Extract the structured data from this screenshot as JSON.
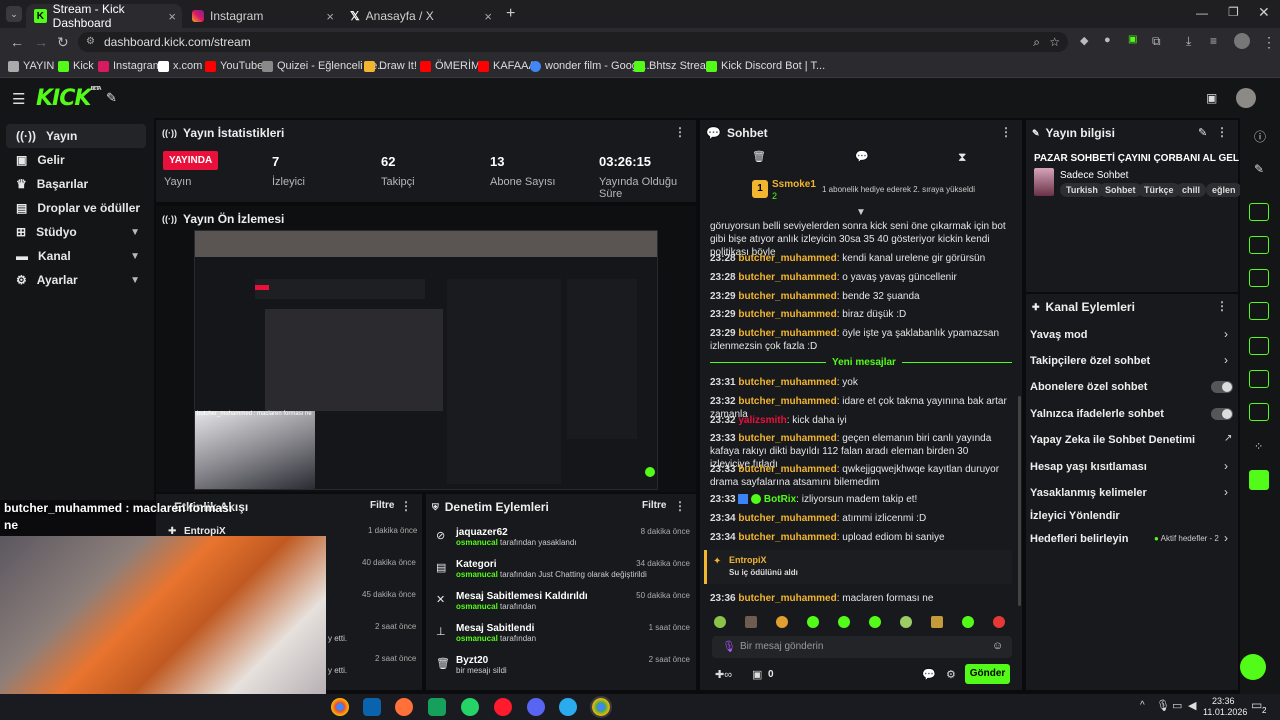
{
  "browser": {
    "tabs": [
      {
        "label": "Stream - Kick Dashboard",
        "active": true
      },
      {
        "label": "Instagram",
        "active": false
      },
      {
        "label": "Anasayfa / X",
        "active": false
      }
    ],
    "url": "dashboard.kick.com/stream",
    "bookmarks": [
      "YAYIN",
      "Kick",
      "Instagram",
      "x.com",
      "YouTube",
      "Quizei - Eğlenceli ve...",
      "Draw It!",
      "ÖMERİM",
      "KAFAAA",
      "wonder film - Googl...",
      "Bhtsz Stream",
      "Kick Discord Bot | T..."
    ]
  },
  "kick": {
    "logo": "KICK",
    "badge": "BETA",
    "accent": "#53fc18"
  },
  "sidebar": {
    "items": [
      {
        "label": "Yayın",
        "icon": "broadcast-icon"
      },
      {
        "label": "Gelir",
        "icon": "wallet-icon"
      },
      {
        "label": "Başarılar",
        "icon": "trophy-icon"
      },
      {
        "label": "Droplar ve ödüller",
        "icon": "gift-icon"
      },
      {
        "label": "Stüdyo",
        "icon": "grid-icon"
      },
      {
        "label": "Kanal",
        "icon": "user-icon"
      },
      {
        "label": "Ayarlar",
        "icon": "gear-icon"
      }
    ]
  },
  "stats": {
    "title": "Yayın İstatistikleri",
    "live_badge": "YAYINDA",
    "live_label": "Yayın",
    "items": [
      {
        "value": "7",
        "label": "İzleyici"
      },
      {
        "value": "62",
        "label": "Takipçi"
      },
      {
        "value": "13",
        "label": "Abone Sayısı"
      },
      {
        "value": "03:26:15",
        "label": "Yayında Olduğu Süre"
      }
    ]
  },
  "preview": {
    "title": "Yayın Ön İzlemesi",
    "overlay_user": "butcher_muhammed",
    "overlay_text": "maclaren forması ne"
  },
  "activity": {
    "title": "Etkinlik Akışı",
    "filter": "Filtre",
    "items": [
      {
        "user": "EntropiX",
        "time": ""
      },
      {
        "user": "",
        "time": "1 dakika önce"
      },
      {
        "user": "",
        "time": "40 dakika önce"
      },
      {
        "user": "",
        "time": "45 dakika önce"
      },
      {
        "user": "",
        "time": "2 saat önce",
        "sub": "y etti."
      },
      {
        "user": "",
        "time": "2 saat önce",
        "sub": "y etti."
      }
    ]
  },
  "audit": {
    "title": "Denetim Eylemleri",
    "filter": "Filtre",
    "items": [
      {
        "title": "jaquazer62",
        "actor": "osmanucal",
        "rest": "tarafından yasaklandı",
        "time": "8 dakika önce",
        "icon": "ban-icon"
      },
      {
        "title": "Kategori",
        "actor": "osmanucal",
        "rest": "tarafından Just Chatting olarak değiştirildi",
        "time": "34 dakika önce",
        "icon": "category-icon"
      },
      {
        "title": "Mesaj Sabitlemesi Kaldırıldı",
        "actor": "osmanucal",
        "rest": "tarafından",
        "time": "50 dakika önce",
        "icon": "unpin-icon"
      },
      {
        "title": "Mesaj Sabitlendi",
        "actor": "osmanucal",
        "rest": "tarafından",
        "time": "1 saat önce",
        "icon": "pin-icon"
      },
      {
        "title": "Byzt20",
        "actor": "",
        "rest": "bir mesajı sildi",
        "time": "2 saat önce",
        "icon": "trash-icon"
      }
    ]
  },
  "chat": {
    "title": "Sohbet",
    "pinned_user": "Ssmoke1",
    "pinned_count": "2",
    "pinned_text": "1 abonelik hediye ederek 2. sıraya yükseldi",
    "separator": "Yeni mesajlar",
    "first_text": "göruyorsun belli seviyelerden sonra kick seni öne çıkarmak için bot gibi bişe atıyor anlık izleyicin 30sa 35 40 gösteriyor kickin kendi politikası böyle",
    "messages": [
      {
        "time": "23:28",
        "user": "butcher_muhammed",
        "text": "kendi kanal urelene gir görürsün"
      },
      {
        "time": "23:28",
        "user": "butcher_muhammed",
        "text": "o yavaş yavaş güncellenir"
      },
      {
        "time": "23:29",
        "user": "butcher_muhammed",
        "text": "bende 32 şuanda"
      },
      {
        "time": "23:29",
        "user": "butcher_muhammed",
        "text": "biraz düşük :D"
      },
      {
        "time": "23:29",
        "user": "butcher_muhammed",
        "text": "öyle işte ya şaklabanlık ypamazsan izlenmezsin çok fazla :D"
      },
      {
        "time": "23:31",
        "user": "butcher_muhammed",
        "text": "yok"
      },
      {
        "time": "23:32",
        "user": "butcher_muhammed",
        "text": "idare et çok takma yayınına bak artar zamanla"
      },
      {
        "time": "23:32",
        "user": "yalizsmith",
        "text": "kick daha iyi"
      },
      {
        "time": "23:33",
        "user": "butcher_muhammed",
        "text": "geçen elemanın biri canlı yayında kafaya rakıyı dikti bayıldı 112 falan aradı eleman birden 30 izleyiciye fırladı"
      },
      {
        "time": "23:33",
        "user": "butcher_muhammed",
        "text": "qwkejjgqwejkhwqe kayıtlan duruyor drama sayfalarına atsamını bilemedim"
      },
      {
        "time": "23:33",
        "user": "BotRix",
        "text": "izliyorsun madem takip et!"
      },
      {
        "time": "23:34",
        "user": "butcher_muhammed",
        "text": "atımmi izlicenmi :D"
      },
      {
        "time": "23:34",
        "user": "butcher_muhammed",
        "text": "upload ediom bi saniye"
      }
    ],
    "reward_user": "EntropiX",
    "reward_text": "Su iç ödülünü aldı",
    "last_time": "23:36",
    "last_user": "butcher_muhammed",
    "last_text": "maclaren forması ne",
    "input_placeholder": "Bir mesaj gönderin",
    "points": "0",
    "send_label": "Gönder"
  },
  "stream_info": {
    "title": "Yayın bilgisi",
    "stream_title": "PAZAR SOHBETİ ÇAYINI ÇORBANI AL GEL",
    "category": "Sadece Sohbet",
    "tags": [
      "Turkish",
      "Sohbet",
      "Türkçe",
      "chill",
      "eğlen"
    ]
  },
  "channel_actions": {
    "title": "Kanal Eylemleri",
    "items": [
      {
        "label": "Yavaş mod",
        "control": "chevron"
      },
      {
        "label": "Takipçilere özel sohbet",
        "control": "chevron"
      },
      {
        "label": "Abonelere özel sohbet",
        "control": "toggle"
      },
      {
        "label": "Yalnızca ifadelerle sohbet",
        "control": "toggle"
      },
      {
        "label": "Yapay Zeka ile Sohbet Denetimi",
        "control": "external"
      },
      {
        "label": "Hesap yaşı kısıtlaması",
        "control": "chevron"
      },
      {
        "label": "Yasaklanmış kelimeler",
        "control": "chevron"
      },
      {
        "label": "İzleyici Yönlendir",
        "control": "none"
      },
      {
        "label": "Hedefleri belirleyin",
        "control": "chevron"
      }
    ],
    "goals_status": "Aktif hedefler - 2"
  },
  "webcam_overlay": {
    "user": "butcher_muhammed",
    "sep": ":",
    "text": "maclaren forması ne"
  },
  "taskbar": {
    "time": "23:36",
    "date": "11.01.2026",
    "notif_count": "2"
  }
}
